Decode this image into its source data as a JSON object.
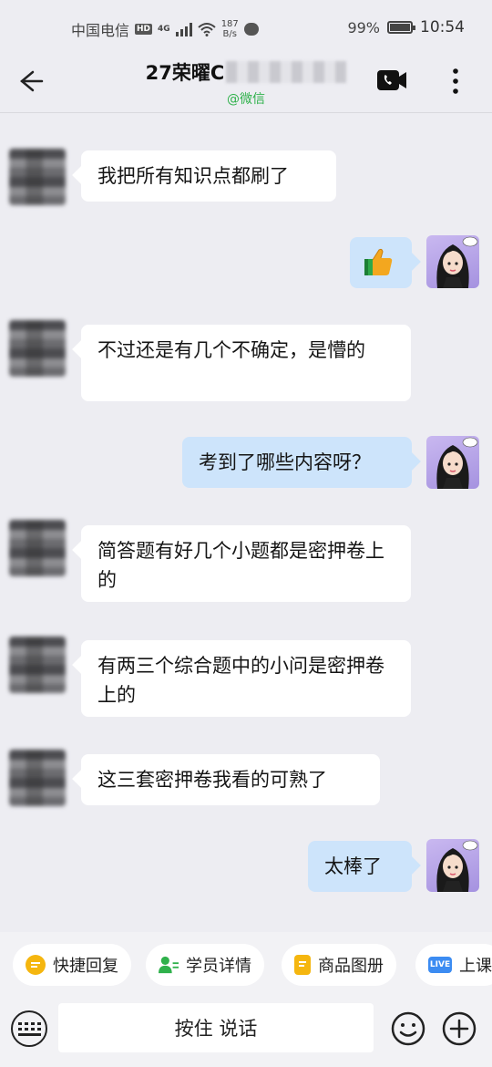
{
  "status_bar": {
    "carrier": "中国电信",
    "hd": "HD",
    "net": "4G",
    "speed_value": "187",
    "speed_unit": "B/s",
    "battery": "99%",
    "battery_level": 0.99,
    "time": "10:54"
  },
  "header": {
    "title": "27荣曜C",
    "subtitle": "@微信"
  },
  "messages": [
    {
      "side": "left",
      "text": "我把所有知识点都刷了"
    },
    {
      "side": "right",
      "text": "👍",
      "icon": "thumbs-up-icon"
    },
    {
      "side": "left",
      "text": "不过还是有几个不确定，是懵的"
    },
    {
      "side": "right",
      "text": "考到了哪些内容呀？"
    },
    {
      "side": "left",
      "text": "简答题有好几个小题都是密押卷上的"
    },
    {
      "side": "left",
      "text": "有两三个综合题中的小问是密押卷上的"
    },
    {
      "side": "left",
      "text": "这三套密押卷我看的可熟了"
    },
    {
      "side": "right",
      "text": "太棒了"
    }
  ],
  "quick_actions": [
    {
      "label": "快捷回复",
      "icon": "quick-reply-icon",
      "color": "#f5b60f"
    },
    {
      "label": "学员详情",
      "icon": "student-detail-icon",
      "color": "#2fb14b"
    },
    {
      "label": "商品图册",
      "icon": "product-album-icon",
      "color": "#f5b60f"
    },
    {
      "label": "上课",
      "icon": "live-icon",
      "color": "#3c8cf2",
      "badge": "LIVE"
    }
  ],
  "input": {
    "hold_to_talk": "按住 说话"
  }
}
